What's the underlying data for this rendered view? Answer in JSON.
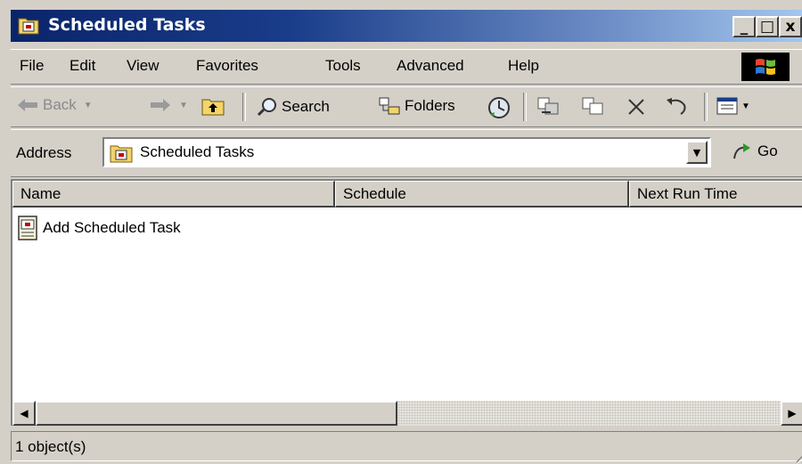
{
  "window": {
    "title": "Scheduled Tasks"
  },
  "caption_buttons": {
    "minimize": "_",
    "maximize": "□",
    "close": "x"
  },
  "menu": {
    "items": [
      "File",
      "Edit",
      "View",
      "Favorites",
      "Tools",
      "Advanced",
      "Help"
    ]
  },
  "toolbar": {
    "back": "Back",
    "search": "Search",
    "folders": "Folders"
  },
  "address": {
    "label": "Address",
    "value": "Scheduled Tasks",
    "go": "Go"
  },
  "list": {
    "columns": [
      "Name",
      "Schedule",
      "Next Run Time"
    ],
    "items": [
      {
        "name": "Add Scheduled Task"
      }
    ]
  },
  "status": {
    "text": "1 object(s)"
  },
  "icons": {
    "title": "scheduled-tasks-folder-icon",
    "winlogo": "windows-logo-icon",
    "back": "back-arrow-icon",
    "forward": "forward-arrow-icon",
    "up": "up-folder-icon",
    "search": "search-icon",
    "folders": "folders-icon",
    "history": "history-icon",
    "move_to": "move-to-icon",
    "copy_to": "copy-to-icon",
    "delete": "delete-icon",
    "undo": "undo-icon",
    "views": "views-icon",
    "go": "go-arrow-icon",
    "task": "add-task-icon"
  },
  "colors": {
    "titlebar_start": "#0a246a",
    "titlebar_end": "#a6caf0",
    "chrome": "#d4d0c8"
  }
}
